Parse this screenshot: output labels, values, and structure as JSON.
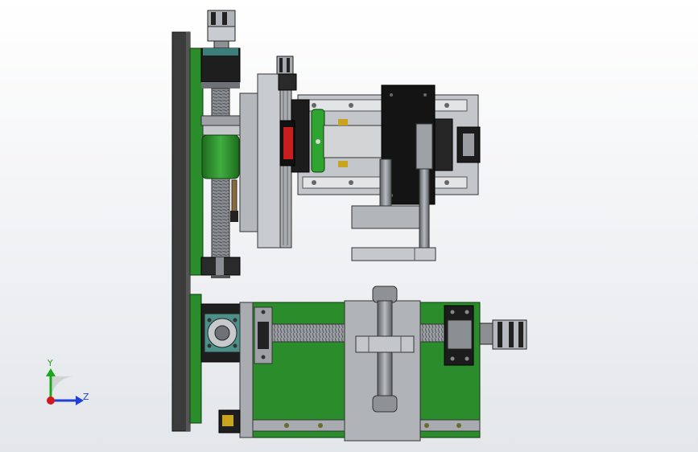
{
  "viewport": {
    "background_top": "#ffffff",
    "background_bottom": "#e3e6ea"
  },
  "triad": {
    "y_label": "Y",
    "z_label": "Z",
    "y_color": "#1aa81a",
    "z_color": "#1f3fd6",
    "x_color": "#d21a1a"
  },
  "model": {
    "plate_color": "#2a8c2a",
    "frame_color": "#3a3a3a",
    "steel_color": "#a9adb3",
    "dark_color": "#1a1a1a"
  }
}
